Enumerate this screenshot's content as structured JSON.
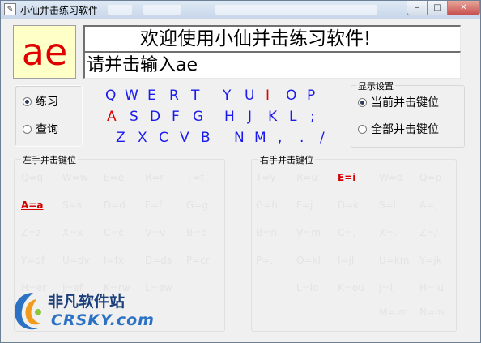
{
  "window": {
    "title": "小仙并击练习软件",
    "controls": {
      "minimize": "–",
      "maximize": "□",
      "close": "✕"
    },
    "icon": "app-icon"
  },
  "display": {
    "big_char": "ae",
    "welcome": "欢迎使用小仙并击练习软件!",
    "prompt": "请并击输入ae"
  },
  "mode": {
    "options": [
      {
        "label": "练习",
        "selected": true
      },
      {
        "label": "查询",
        "selected": false
      }
    ]
  },
  "display_settings": {
    "title": "显示设置",
    "options": [
      {
        "label": "当前并击键位",
        "selected": true
      },
      {
        "label": "全部并击键位",
        "selected": false
      }
    ]
  },
  "keyboard": {
    "rows": [
      [
        "Q",
        "W",
        "E",
        "R",
        "T",
        "Y",
        "U",
        "I",
        "O",
        "P"
      ],
      [
        "A",
        "S",
        "D",
        "F",
        "G",
        "H",
        "J",
        "K",
        "L",
        ";"
      ],
      [
        "Z",
        "X",
        "C",
        "V",
        "B",
        "N",
        "M",
        ",",
        ".",
        "/"
      ]
    ],
    "highlighted": [
      "I",
      "A"
    ],
    "colors": {
      "normal": "#1a1aee",
      "highlight": "#e00000"
    }
  },
  "left_hand": {
    "title": "左手并击键位",
    "combos": [
      [
        "Q=q",
        "W=w",
        "E=e",
        "R=r",
        "T=t"
      ],
      [
        "A=a",
        "S=s",
        "D=d",
        "F=f",
        "G=g"
      ],
      [
        "Z=z",
        "X=x",
        "C=c",
        "V=v",
        "B=b"
      ],
      [
        "Y=df",
        "U=dv",
        "I=fx",
        "D=ds",
        "P=cr"
      ],
      [
        "H=er",
        "J=ef",
        "K=rw",
        "L=ew"
      ]
    ],
    "active": "A=a"
  },
  "right_hand": {
    "title": "右手并击键位",
    "combos": [
      [
        "T=y",
        "R=u",
        "E=i",
        "W=o",
        "Q=p"
      ],
      [
        "G=h",
        "F=j",
        "D=k",
        "S=l",
        "A=;"
      ],
      [
        "B=n",
        "V=m",
        "C=,",
        "X=.",
        "Z=/"
      ],
      [
        "P=,.",
        "O=kl",
        "I=jl",
        "U=km",
        "Y=jk"
      ],
      [
        "L=io",
        "K=ou",
        "J=ij",
        "H=iu"
      ],
      [
        "M=.m",
        "N=m"
      ]
    ],
    "active": "E=i"
  },
  "watermark": {
    "name": "非凡软件站",
    "domain": "CRSKY.com"
  }
}
